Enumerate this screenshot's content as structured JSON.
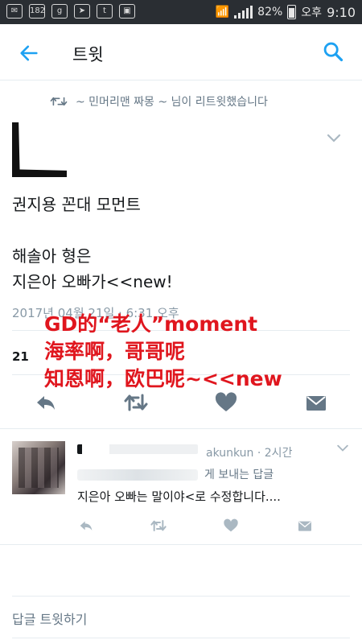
{
  "statusbar": {
    "notif_count": "182",
    "battery": "82%",
    "ampm": "오후",
    "time": "9:10"
  },
  "toolbar": {
    "title": "트윗"
  },
  "retweet_banner": {
    "text": "~ 민머리맨 짜몽 ~ 님이 리트윗했습니다"
  },
  "tweet": {
    "text": "권지용 꼰대 모먼트\n\n해솔아 형은\n지은아 오빠가<<new!",
    "timestamp": "2017년 04월 21일 · 6:31 오후",
    "retweet_count": "21"
  },
  "overlay_caption": {
    "text": "GD的“老人”moment\n海率啊，哥哥呢\n知恩啊，欧巴呢~<<new"
  },
  "reply": {
    "handle_time": "akunkun · 2시간",
    "reply_to_suffix": "게 보내는 답글",
    "text": "지은아 오빠는 말이야<로 수정합니다...."
  },
  "compose": {
    "placeholder": "답글 트윗하기"
  },
  "colors": {
    "accent": "#1da1f2",
    "icon_gray": "#657786",
    "overlay_red": "#e0161e"
  },
  "icons": [
    "back-arrow-icon",
    "search-icon",
    "retweet-icon",
    "chevron-down-icon",
    "reply-icon",
    "like-icon",
    "message-icon"
  ]
}
